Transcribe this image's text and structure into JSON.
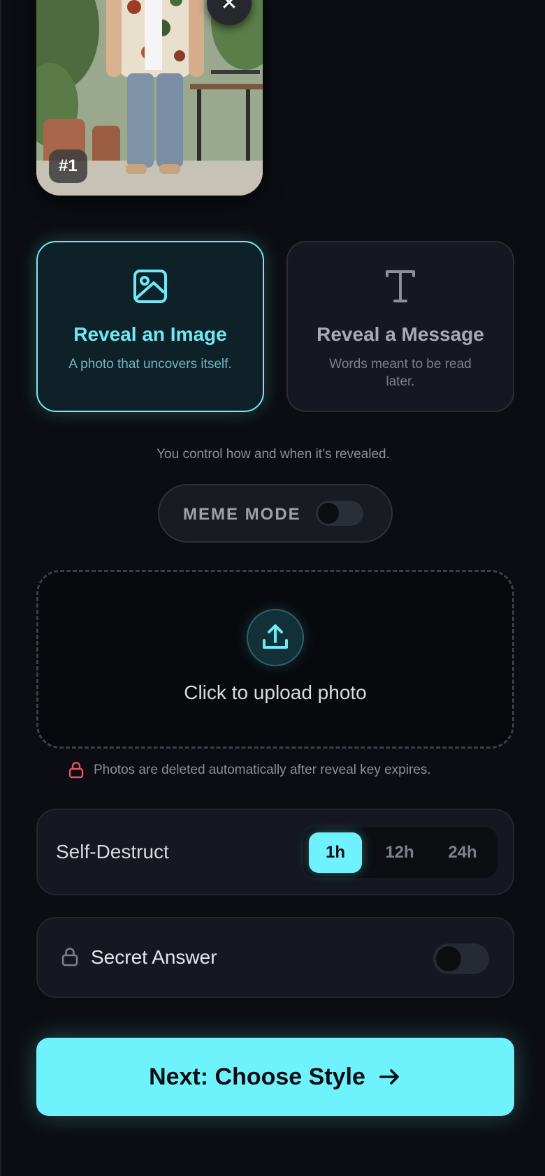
{
  "photo": {
    "badge": "#1",
    "close_icon": "close-icon"
  },
  "modes": [
    {
      "title": "Reveal an Image",
      "subtitle": "A photo that uncovers itself.",
      "icon": "image-icon",
      "selected": true
    },
    {
      "title": "Reveal a Message",
      "subtitle": "Words meant to be read later.",
      "icon": "text-icon",
      "selected": false
    }
  ],
  "control_note": "You control how and when it’s revealed.",
  "meme_mode": {
    "label": "MEME MODE",
    "enabled": false
  },
  "upload": {
    "label": "Click to upload photo",
    "icon": "upload-icon"
  },
  "privacy_note": "Photos are deleted automatically after reveal key expires.",
  "self_destruct": {
    "label": "Self-Destruct",
    "options": [
      "1h",
      "12h",
      "24h"
    ],
    "selected": "1h"
  },
  "secret_answer": {
    "label": "Secret Answer",
    "enabled": false
  },
  "cta": {
    "label": "Next: Choose Style",
    "icon": "arrow-right-icon"
  },
  "colors": {
    "accent": "#6ef3fd",
    "background": "#0b0d12",
    "card": "#151820",
    "lock_red": "#e2556b"
  }
}
